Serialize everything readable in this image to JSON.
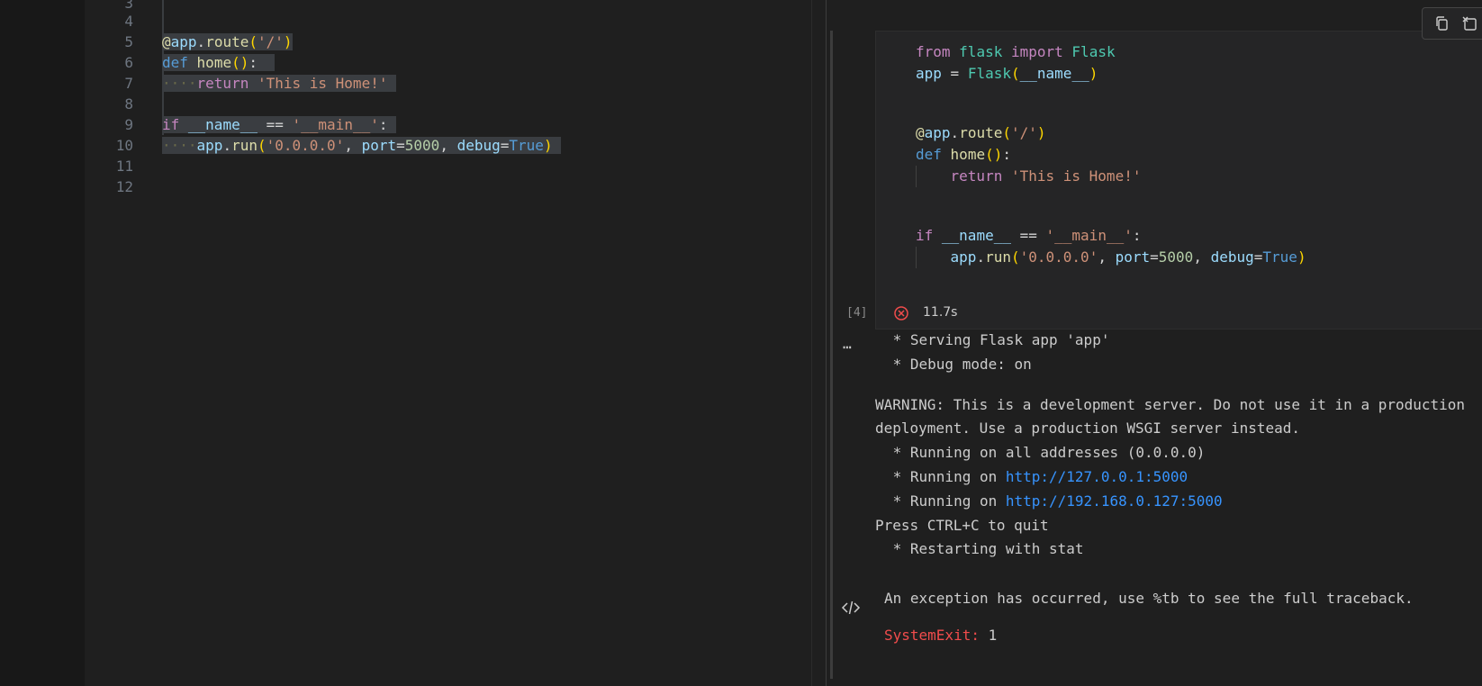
{
  "editor": {
    "line_numbers": [
      "3",
      "4",
      "5",
      "6",
      "7",
      "8",
      "9",
      "10",
      "11",
      "12"
    ]
  },
  "notebook": {
    "execution_count": "[4]",
    "duration": "11.7s",
    "status": "error",
    "output_lines": [
      " * Serving Flask app 'app'",
      " * Debug mode: on",
      "WARNING: This is a development server. Do not use it in a production",
      "deployment. Use a production WSGI server instead.",
      " * Running on all addresses (0.0.0.0)",
      " * Running on ",
      " * Running on ",
      "Press CTRL+C to quit",
      " * Restarting with stat"
    ],
    "output_links": [
      "http://127.0.0.1:5000",
      "http://192.168.0.127:5000"
    ],
    "exception_message": "An exception has occurred, use %tb to see the full traceback.",
    "exception_type": "SystemExit:",
    "exception_value": "1"
  },
  "colors": {
    "background": "#1f1f1f",
    "keyword": "#569cd6",
    "control": "#c586c0",
    "string": "#ce9178",
    "link": "#3794ff",
    "error": "#f14c4c"
  },
  "icons": [
    "copy-icon",
    "clear-output-icon",
    "error-status-icon",
    "more-ellipsis-icon",
    "code-output-icon"
  ]
}
